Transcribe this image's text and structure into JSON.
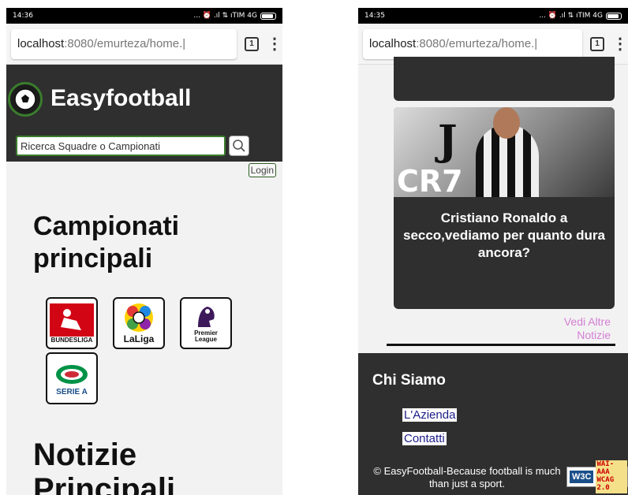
{
  "left": {
    "status": {
      "time": "14:36",
      "icons": "... ⏰ .ıl ⇅ ıTIM 4G"
    },
    "browser": {
      "url_host": "localhost",
      "url_rest": ":8080/emurteza/home.|",
      "tab_count": "1",
      "menu": "⋮"
    },
    "header": {
      "brand": "Easyfootball",
      "search_placeholder": "Ricerca Squadre o Campionati"
    },
    "login": "Login",
    "section_title": "Campionati principali",
    "leagues": [
      {
        "name": "BUNDESLIGA",
        "icon": "bundesliga-logo"
      },
      {
        "name": "LaLiga",
        "icon": "laliga-logo"
      },
      {
        "name": "Premier League",
        "icon": "premier-league-logo"
      },
      {
        "name": "SERIE A",
        "icon": "serie-a-logo"
      }
    ],
    "news_title": "Notizie Principali"
  },
  "right": {
    "status": {
      "time": "14:35",
      "icons": "... ⏰ .ıl ⇅ ıTIM 4G"
    },
    "browser": {
      "url_host": "localhost",
      "url_rest": ":8080/emurteza/home.|",
      "tab_count": "1",
      "menu": "⋮"
    },
    "news_card": {
      "image_text": "CR7",
      "badge_text": "J",
      "title": "Cristiano Ronaldo a secco,vediamo per quanto dura ancora?"
    },
    "vedi_altre": "Vedi Altre Notizie",
    "footer": {
      "heading": "Chi Siamo",
      "links": [
        "L'Azienda",
        "Contatti"
      ],
      "copyright": "© EasyFootball-Because football is much than just a sport.",
      "badge_w3c": "W3C",
      "badge_wai": "WAI-AAA WCAG 2.0"
    }
  },
  "colors": {
    "header_bg": "#2f2f2f",
    "accent_green": "#3a7d2c",
    "link_pink": "#d47fd4"
  }
}
